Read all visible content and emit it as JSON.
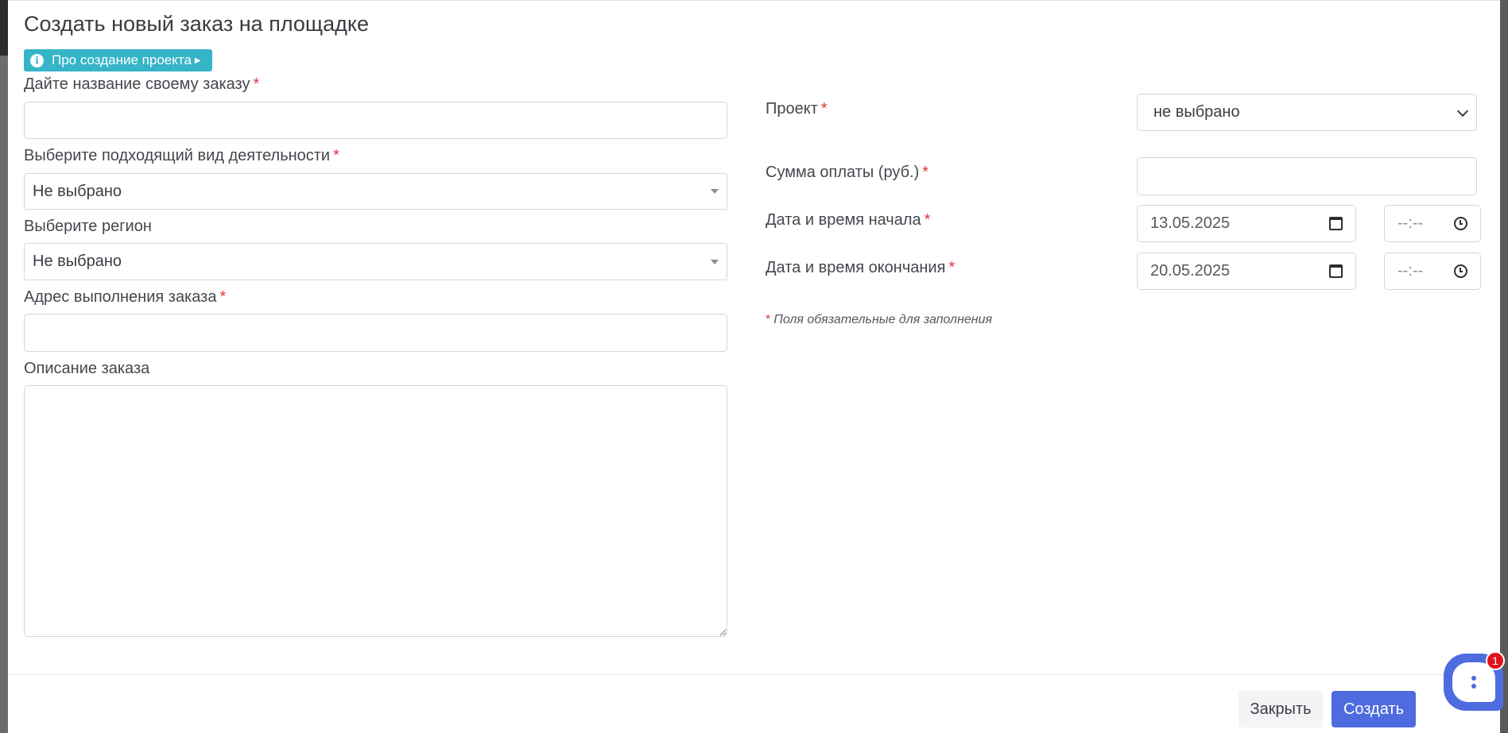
{
  "modal": {
    "title": "Создать новый заказ на площадке",
    "info_button": "Про создание проекта",
    "required_mark": "*"
  },
  "left": {
    "order_name": {
      "label": "Дайте название своему заказу",
      "value": ""
    },
    "activity": {
      "label": "Выберите подходящий вид деятельности",
      "selected": "Не выбрано"
    },
    "region": {
      "label": "Выберите регион",
      "selected": "Не выбрано"
    },
    "address": {
      "label": "Адрес выполнения заказа",
      "value": ""
    },
    "description": {
      "label": "Описание заказа",
      "value": ""
    }
  },
  "right": {
    "project": {
      "label": "Проект",
      "selected": "не выбрано"
    },
    "payment": {
      "label": "Сумма оплаты (руб.)",
      "value": ""
    },
    "start": {
      "label": "Дата и время начала",
      "date": "13.05.2025",
      "time": "--:--"
    },
    "end": {
      "label": "Дата и время окончания",
      "date": "20.05.2025",
      "time": "--:--"
    },
    "note": "Поля обязательные для заполнения"
  },
  "footer": {
    "close_label": "Закрыть",
    "create_label": "Создать"
  },
  "chat": {
    "badge_count": "1"
  },
  "colors": {
    "primary": "#4e6be0",
    "info": "#36b5c8",
    "required": "#e0373f",
    "badge": "#e0141e"
  },
  "icons": {
    "info": "info-icon",
    "calendar": "calendar-icon",
    "clock": "clock-icon",
    "chat": "chat-icon"
  }
}
